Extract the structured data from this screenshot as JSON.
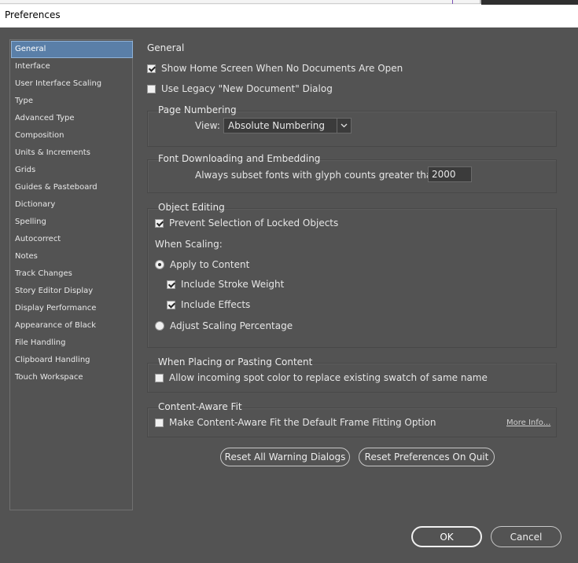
{
  "window": {
    "title": "Preferences"
  },
  "sidebar": {
    "items": [
      {
        "label": "General",
        "selected": true
      },
      {
        "label": "Interface"
      },
      {
        "label": "User Interface Scaling"
      },
      {
        "label": "Type"
      },
      {
        "label": "Advanced Type"
      },
      {
        "label": "Composition"
      },
      {
        "label": "Units & Increments"
      },
      {
        "label": "Grids"
      },
      {
        "label": "Guides & Pasteboard"
      },
      {
        "label": "Dictionary"
      },
      {
        "label": "Spelling"
      },
      {
        "label": "Autocorrect"
      },
      {
        "label": "Notes"
      },
      {
        "label": "Track Changes"
      },
      {
        "label": "Story Editor Display"
      },
      {
        "label": "Display Performance"
      },
      {
        "label": "Appearance of Black"
      },
      {
        "label": "File Handling"
      },
      {
        "label": "Clipboard Handling"
      },
      {
        "label": "Touch Workspace"
      }
    ]
  },
  "main": {
    "title": "General",
    "show_home_screen": {
      "label": "Show Home Screen When No Documents Are Open",
      "checked": true
    },
    "use_legacy_dialog": {
      "label": "Use Legacy \"New Document\" Dialog",
      "checked": false
    },
    "page_numbering": {
      "title": "Page Numbering",
      "view_label": "View:",
      "view_value": "Absolute Numbering"
    },
    "font_downloading": {
      "title": "Font Downloading and Embedding",
      "subset_label": "Always subset fonts with glyph counts greater than:",
      "subset_value": "2000"
    },
    "object_editing": {
      "title": "Object Editing",
      "prevent_locked": {
        "label": "Prevent Selection of Locked Objects",
        "checked": true
      },
      "when_scaling": "When Scaling:",
      "apply_to_content": {
        "label": "Apply to Content",
        "selected": true
      },
      "include_stroke": {
        "label": "Include Stroke Weight",
        "checked": true
      },
      "include_effects": {
        "label": "Include Effects",
        "checked": true
      },
      "adjust_scaling": {
        "label": "Adjust Scaling Percentage",
        "selected": false
      }
    },
    "placing": {
      "title": "When Placing or Pasting Content",
      "spot_color": {
        "label": "Allow incoming spot color to replace existing swatch of same name",
        "checked": false
      }
    },
    "content_aware": {
      "title": "Content-Aware Fit",
      "default_option": {
        "label": "Make Content-Aware Fit the Default Frame Fitting Option",
        "checked": false
      },
      "more_info": "More Info..."
    },
    "buttons": {
      "reset_warnings": "Reset All Warning Dialogs",
      "reset_prefs": "Reset Preferences On Quit"
    }
  },
  "footer": {
    "ok": "OK",
    "cancel": "Cancel"
  }
}
